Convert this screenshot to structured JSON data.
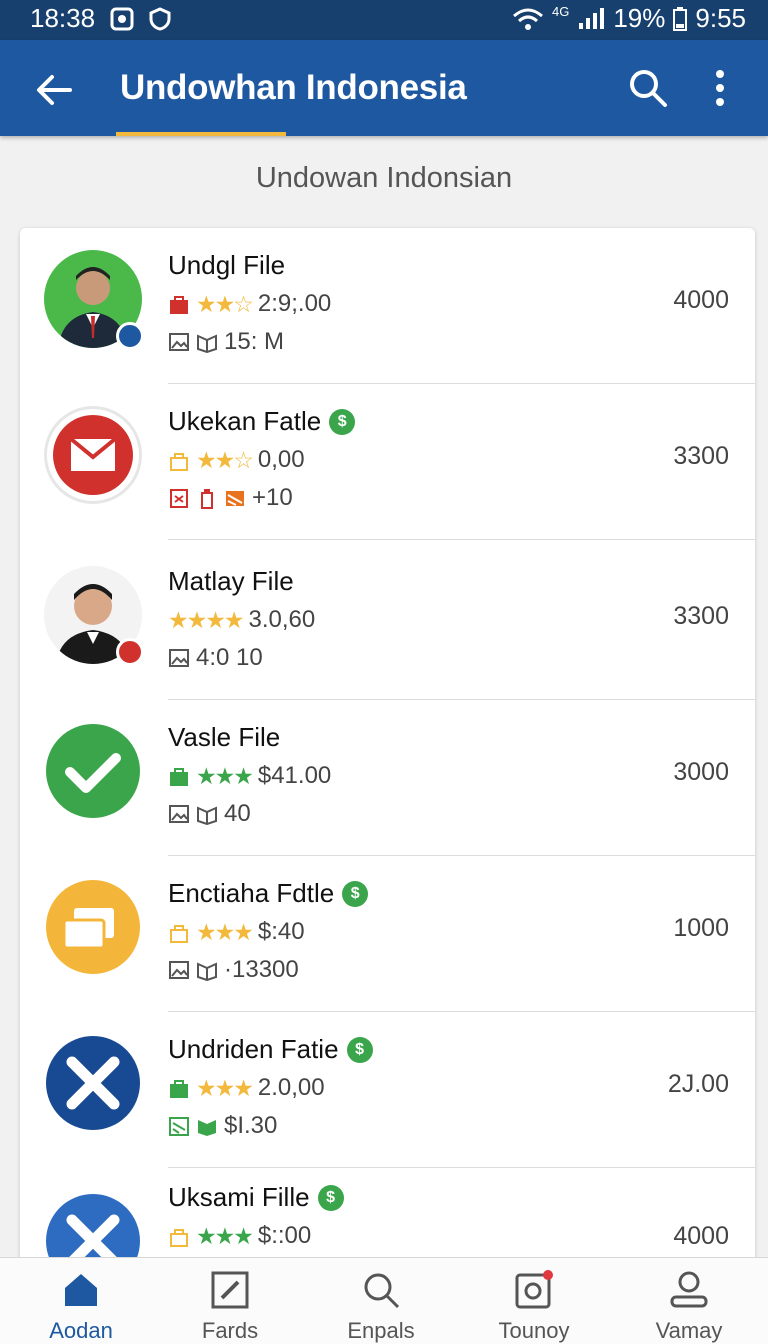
{
  "status_bar": {
    "time_left": "18:38",
    "network": "4G",
    "battery": "19%",
    "time_right": "9:55"
  },
  "app_bar": {
    "title": "Undowhan Indonesia",
    "back_icon": "arrow-left-icon",
    "search_icon": "search-icon",
    "more_icon": "more-vert-icon"
  },
  "section_title": "Undowan Indonsian",
  "colors": {
    "app_bar": "#1d58a0",
    "status_bar": "#17406f",
    "accent": "#f2b93c",
    "star": "#f2b93c",
    "green": "#3aa54a",
    "red": "#d0312d"
  },
  "items": [
    {
      "name": "Undgl File",
      "dollar": false,
      "rating": 2.5,
      "meta1": "2:9;.00",
      "meta2": "15: M",
      "amount": "4000",
      "avatar": "person-photo"
    },
    {
      "name": "Ukekan Fatle",
      "dollar": true,
      "rating": 3,
      "meta1": "0,00",
      "meta2": "+10",
      "amount": "3300",
      "avatar": "mail-icon"
    },
    {
      "name": "Matlay File",
      "dollar": false,
      "rating": 4,
      "meta1": "3.0,60",
      "meta2": "4:0 10",
      "amount": "3300",
      "avatar": "person-photo"
    },
    {
      "name": "Vasle File",
      "dollar": false,
      "rating": 3,
      "meta1": "$41.00",
      "meta2": "40",
      "amount": "3000",
      "avatar": "check-icon"
    },
    {
      "name": "Enctiaha Fdtle",
      "dollar": true,
      "rating": 3,
      "meta1": "$:40",
      "meta2": "·13300",
      "amount": "1000",
      "avatar": "folder-icon"
    },
    {
      "name": "Undriden Fatie",
      "dollar": true,
      "rating": 3,
      "meta1": "2.0,00",
      "meta2": "$I.30",
      "amount": "2J.00",
      "avatar": "x-logo-icon"
    },
    {
      "name": "Uksami Fille",
      "dollar": true,
      "rating": 3,
      "meta1": "$::00",
      "meta2": "",
      "amount": "4000",
      "avatar": "x-logo-icon"
    }
  ],
  "bottom_nav": [
    {
      "label": "Aodan",
      "icon": "home-icon",
      "active": true
    },
    {
      "label": "Fards",
      "icon": "edit-icon",
      "active": false
    },
    {
      "label": "Enpals",
      "icon": "search-icon",
      "active": false
    },
    {
      "label": "Tounoy",
      "icon": "camera-icon",
      "active": false
    },
    {
      "label": "Vamay",
      "icon": "person-icon",
      "active": false
    }
  ]
}
